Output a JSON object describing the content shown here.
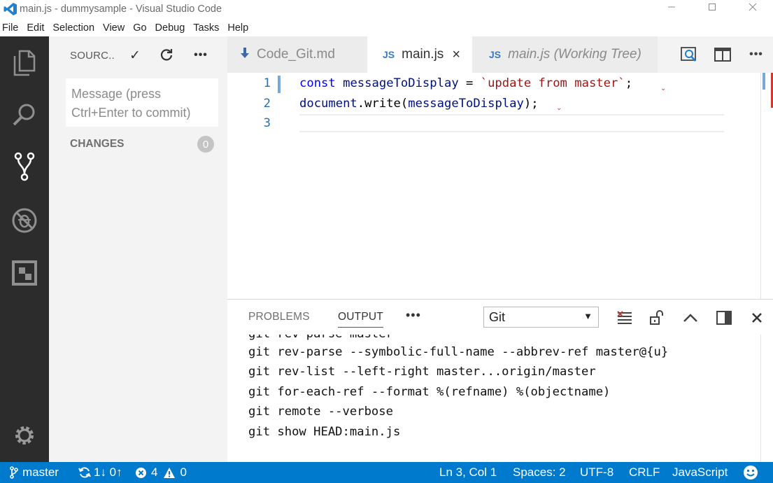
{
  "window": {
    "title": "main.js - dummysample - Visual Studio Code",
    "controls": [
      "minimize",
      "maximize",
      "close"
    ]
  },
  "menu": [
    "File",
    "Edit",
    "Selection",
    "View",
    "Go",
    "Debug",
    "Tasks",
    "Help"
  ],
  "activity_bar": {
    "items": [
      "explorer-icon",
      "search-icon",
      "source-control-icon",
      "debug-icon",
      "extensions-icon"
    ],
    "bottom": "gear-icon"
  },
  "sidebar": {
    "title": "SOURC..",
    "actions": [
      "check-icon",
      "refresh-icon",
      "more-icon"
    ],
    "commit_placeholder": "Message (press Ctrl+Enter to commit)",
    "changes_label": "CHANGES",
    "changes_count": "0"
  },
  "tabs": [
    {
      "label": "Code_Git.md",
      "icon": "markdown-icon",
      "active": false
    },
    {
      "label": "main.js",
      "icon_text": "JS",
      "active": true,
      "close": "×"
    },
    {
      "label": "main.js (Working Tree)",
      "icon_text": "JS",
      "active": false
    }
  ],
  "tab_actions": [
    "open-changes-icon",
    "split-editor-icon",
    "more-icon"
  ],
  "editor": {
    "lines": [
      {
        "n": "1",
        "tokens": [
          {
            "t": "const",
            "c": "kw"
          },
          {
            "t": " ",
            "c": "plain"
          },
          {
            "t": "messageToDisplay",
            "c": "id"
          },
          {
            "t": " = ",
            "c": "plain"
          },
          {
            "t": "`update from master`",
            "c": "str"
          },
          {
            "t": ";",
            "c": "plain"
          }
        ]
      },
      {
        "n": "2",
        "tokens": [
          {
            "t": "document",
            "c": "id"
          },
          {
            "t": ".",
            "c": "plain"
          },
          {
            "t": "write",
            "c": "plain"
          },
          {
            "t": "(",
            "c": "plain"
          },
          {
            "t": "messageToDisplay",
            "c": "id"
          },
          {
            "t": ");",
            "c": "plain"
          }
        ]
      },
      {
        "n": "3",
        "tokens": []
      }
    ]
  },
  "panel": {
    "tabs": [
      "PROBLEMS",
      "OUTPUT"
    ],
    "more": "•••",
    "channel": "Git",
    "actions": [
      "clear-output-icon",
      "lock-icon",
      "maximize-panel-icon",
      "toggle-panel-icon",
      "close-icon"
    ],
    "output_lines": [
      "git rev-parse master",
      "git rev-parse --symbolic-full-name --abbrev-ref master@{u}",
      "git rev-list --left-right master...origin/master",
      "git for-each-ref --format %(refname) %(objectname)",
      "git remote --verbose",
      "git show HEAD:main.js"
    ]
  },
  "status": {
    "branch": "master",
    "sync": "1↓ 0↑",
    "errors": "4",
    "warnings": "0",
    "position": "Ln 3, Col 1",
    "spaces": "Spaces: 2",
    "encoding": "UTF-8",
    "eol": "CRLF",
    "language": "JavaScript",
    "feedback": "smiley-icon"
  },
  "colors": {
    "accent": "#007acc",
    "activity_bar": "#2c2c2c",
    "sidebar": "#f3f3f3",
    "keyword": "#0000ff",
    "string": "#a31515",
    "identifier": "#001080"
  }
}
